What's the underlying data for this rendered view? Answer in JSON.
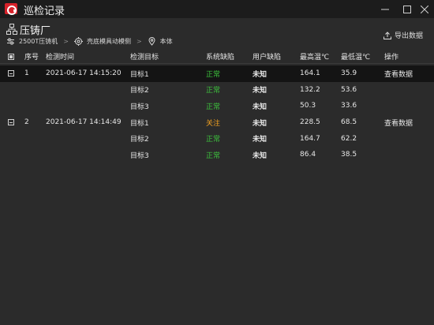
{
  "window": {
    "title": "巡检记录",
    "buttons": [
      "minimize",
      "maximize",
      "close"
    ]
  },
  "header": {
    "plant_name": "压铸厂",
    "breadcrumb": [
      "2500T压铸机",
      "壳底模具动模侧",
      "本体"
    ],
    "export_label": "导出数据"
  },
  "table": {
    "columns": [
      "序号",
      "检测时间",
      "检测目标",
      "系统缺陷",
      "用户缺陷",
      "最高温℃",
      "最低温℃",
      "操作"
    ],
    "groups": [
      {
        "seq": "1",
        "time": "2021-06-17 14:15:20",
        "action": "查看数据",
        "selected": true,
        "rows": [
          {
            "target": "目标1",
            "system_defect": "正常",
            "user_defect": "未知",
            "max_temp": "164.1",
            "min_temp": "35.9"
          },
          {
            "target": "目标2",
            "system_defect": "正常",
            "user_defect": "未知",
            "max_temp": "132.2",
            "min_temp": "53.6"
          },
          {
            "target": "目标3",
            "system_defect": "正常",
            "user_defect": "未知",
            "max_temp": "50.3",
            "min_temp": "33.6"
          }
        ]
      },
      {
        "seq": "2",
        "time": "2021-06-17 14:14:49",
        "action": "查看数据",
        "selected": false,
        "rows": [
          {
            "target": "目标1",
            "system_defect": "关注",
            "user_defect": "未知",
            "max_temp": "228.5",
            "min_temp": "68.5"
          },
          {
            "target": "目标2",
            "system_defect": "正常",
            "user_defect": "未知",
            "max_temp": "164.7",
            "min_temp": "62.2"
          },
          {
            "target": "目标3",
            "system_defect": "正常",
            "user_defect": "未知",
            "max_temp": "86.4",
            "min_temp": "38.5"
          }
        ]
      }
    ]
  },
  "status_colors": {
    "正常": "#3cc23c",
    "关注": "#f0a020"
  },
  "theme": {
    "background": "#2b2b2b",
    "titlebar": "#1c1c1c",
    "selected_row": "#141414",
    "brand": "#d7222a"
  }
}
